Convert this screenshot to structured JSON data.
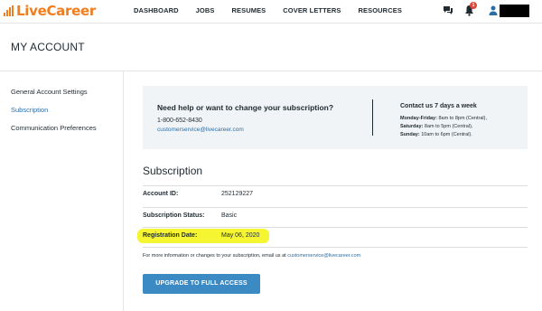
{
  "brand": {
    "name": "LiveCareer",
    "color": "#f07d1e"
  },
  "nav": {
    "items": [
      "DASHBOARD",
      "JOBS",
      "RESUMES",
      "COVER LETTERS",
      "RESOURCES"
    ]
  },
  "header_icons": {
    "chat": "chat-icon",
    "notifications": "bell-icon",
    "notification_count": "1",
    "user": "user-icon"
  },
  "page": {
    "title": "MY ACCOUNT"
  },
  "sidebar": {
    "items": [
      {
        "label": "General Account Settings",
        "active": false
      },
      {
        "label": "Subscription",
        "active": true
      },
      {
        "label": "Communication Preferences",
        "active": false
      }
    ]
  },
  "help": {
    "title": "Need help or want to change your subscription?",
    "phone": "1-800-652-8430",
    "email": "customerservice@livecareer.com",
    "contact_title": "Contact us 7 days a week",
    "hours": [
      {
        "day": "Monday-Friday:",
        "time": " 8am to 8pm (Central),"
      },
      {
        "day": "Saturday:",
        "time": " 8am to 5pm (Central),"
      },
      {
        "day": "Sunday:",
        "time": " 10am to 6pm (Central)."
      }
    ]
  },
  "subscription": {
    "title": "Subscription",
    "rows": [
      {
        "label": "Account ID:",
        "value": "252129227"
      },
      {
        "label": "Subscription Status:",
        "value": "Basic"
      },
      {
        "label": "Registration Date:",
        "value": "May 06, 2020"
      }
    ],
    "footnote": "For more information or changes to your subscription, email us at ",
    "footnote_email": "customerservice@livecareer.com",
    "upgrade_label": "UPGRADE TO FULL ACCESS"
  },
  "colors": {
    "accent": "#2a6ea8",
    "button": "#3c8ac4",
    "highlight": "#f5f531",
    "badge": "#e0463a"
  }
}
